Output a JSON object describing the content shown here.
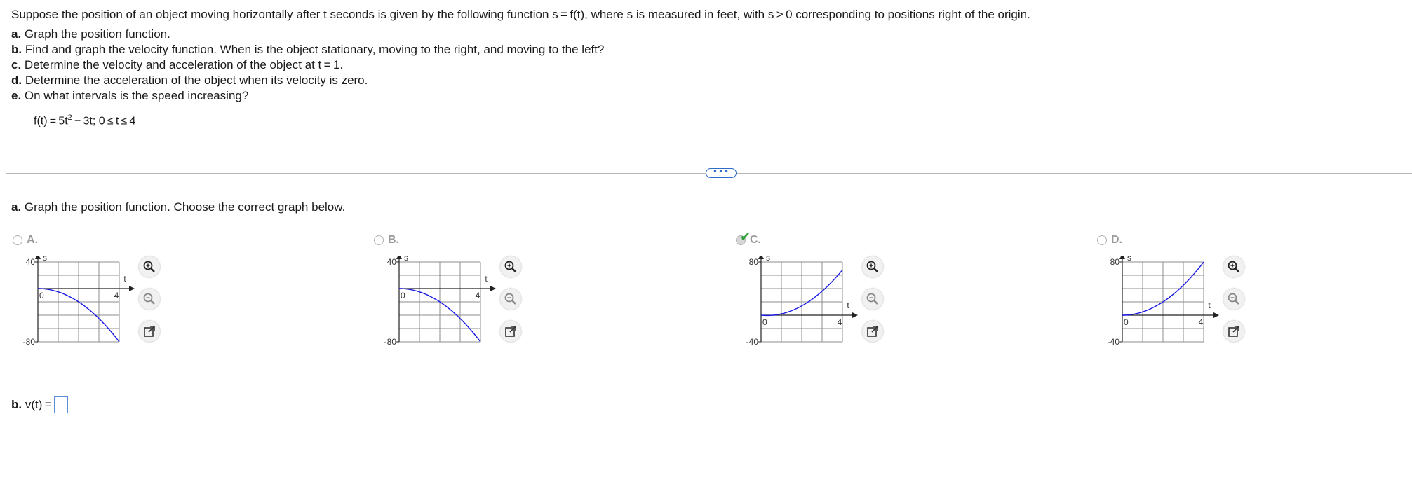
{
  "problem": {
    "intro": "Suppose the position of an object moving horizontally after t seconds is given by the following function s = f(t), where s is measured in feet, with s > 0 corresponding to positions right of the origin.",
    "items": [
      {
        "label": "a.",
        "text": "Graph the position function."
      },
      {
        "label": "b.",
        "text": "Find and graph the velocity function. When is the object stationary, moving to the right, and moving to the left?"
      },
      {
        "label": "c.",
        "text": "Determine the velocity and acceleration of the object at t = 1."
      },
      {
        "label": "d.",
        "text": "Determine the acceleration of the object when its velocity is zero."
      },
      {
        "label": "e.",
        "text": "On what intervals is the speed increasing?"
      }
    ],
    "function_lhs": "f(t) = 5t",
    "function_exp": "2",
    "function_rhs": " − 3t; 0 ≤ t ≤ 4"
  },
  "more_button": "•••",
  "part_a": {
    "label": "a.",
    "text": "Graph the position function. Choose the correct graph below."
  },
  "options": [
    {
      "letter": "A.",
      "selected": false,
      "y_top_label": "40",
      "y_bottom_label": "-80",
      "origin_label": "0",
      "x_label": "4",
      "s_label": "s",
      "t_label": "t",
      "ylim": [
        -80,
        40
      ],
      "xlim": [
        0,
        4
      ],
      "curve": "t -> -5t^2 (approx.)"
    },
    {
      "letter": "B.",
      "selected": false,
      "y_top_label": "40",
      "y_bottom_label": "-80",
      "origin_label": "0",
      "x_label": "4",
      "s_label": "s",
      "t_label": "t",
      "ylim": [
        -80,
        40
      ],
      "xlim": [
        0,
        4
      ],
      "curve": "t -> -5t^2 (approx.)"
    },
    {
      "letter": "C.",
      "selected": true,
      "y_top_label": "80",
      "y_bottom_label": "-40",
      "origin_label": "0",
      "x_label": "4",
      "s_label": "s",
      "t_label": "t",
      "ylim": [
        -40,
        80
      ],
      "xlim": [
        0,
        4
      ],
      "curve": "t -> 5t^2 - 3t"
    },
    {
      "letter": "D.",
      "selected": false,
      "y_top_label": "80",
      "y_bottom_label": "-40",
      "origin_label": "0",
      "x_label": "4",
      "s_label": "s",
      "t_label": "t",
      "ylim": [
        -40,
        80
      ],
      "xlim": [
        0,
        4
      ],
      "curve": "t -> 5t^2 (approx.)"
    }
  ],
  "part_b": {
    "label": "b.",
    "text": "v(t) ="
  },
  "colors": {
    "curve": "#1a1ae6",
    "grid": "#8c8c8c",
    "check": "#2e9e3a",
    "accent": "#2e6cc7"
  }
}
